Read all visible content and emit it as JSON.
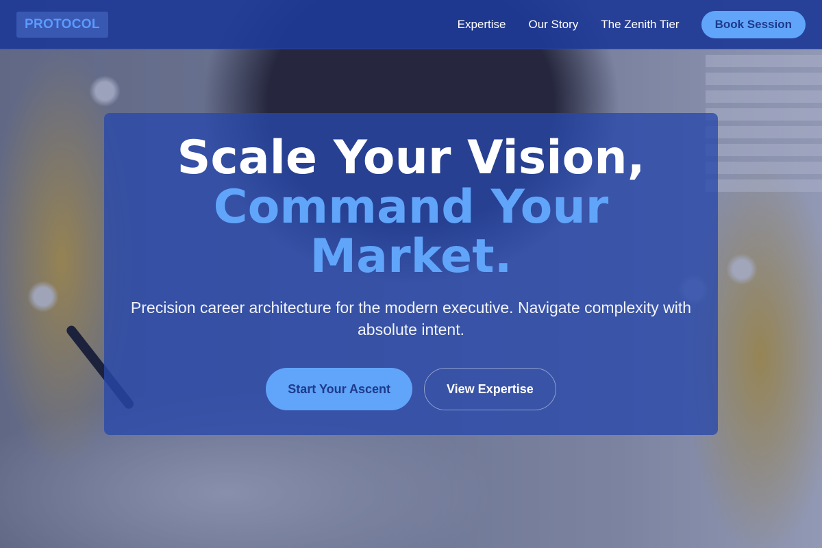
{
  "header": {
    "logo": "PROTOCOL",
    "nav": [
      "Expertise",
      "Our Story",
      "The Zenith Tier"
    ],
    "cta_label": "Book Session"
  },
  "hero": {
    "headline_line1": "Scale Your Vision,",
    "headline_line2": "Command Your",
    "headline_line3": "Market.",
    "subtext": "Precision career architecture for the modern executive. Navigate complexity with absolute intent.",
    "primary_cta": "Start Your Ascent",
    "secondary_cta": "View Expertise"
  },
  "colors": {
    "header_bg": "#1e3a96",
    "accent": "#60a5fa",
    "accent_text": "#1e3a8a",
    "hero_card_bg": "#2848aa"
  }
}
